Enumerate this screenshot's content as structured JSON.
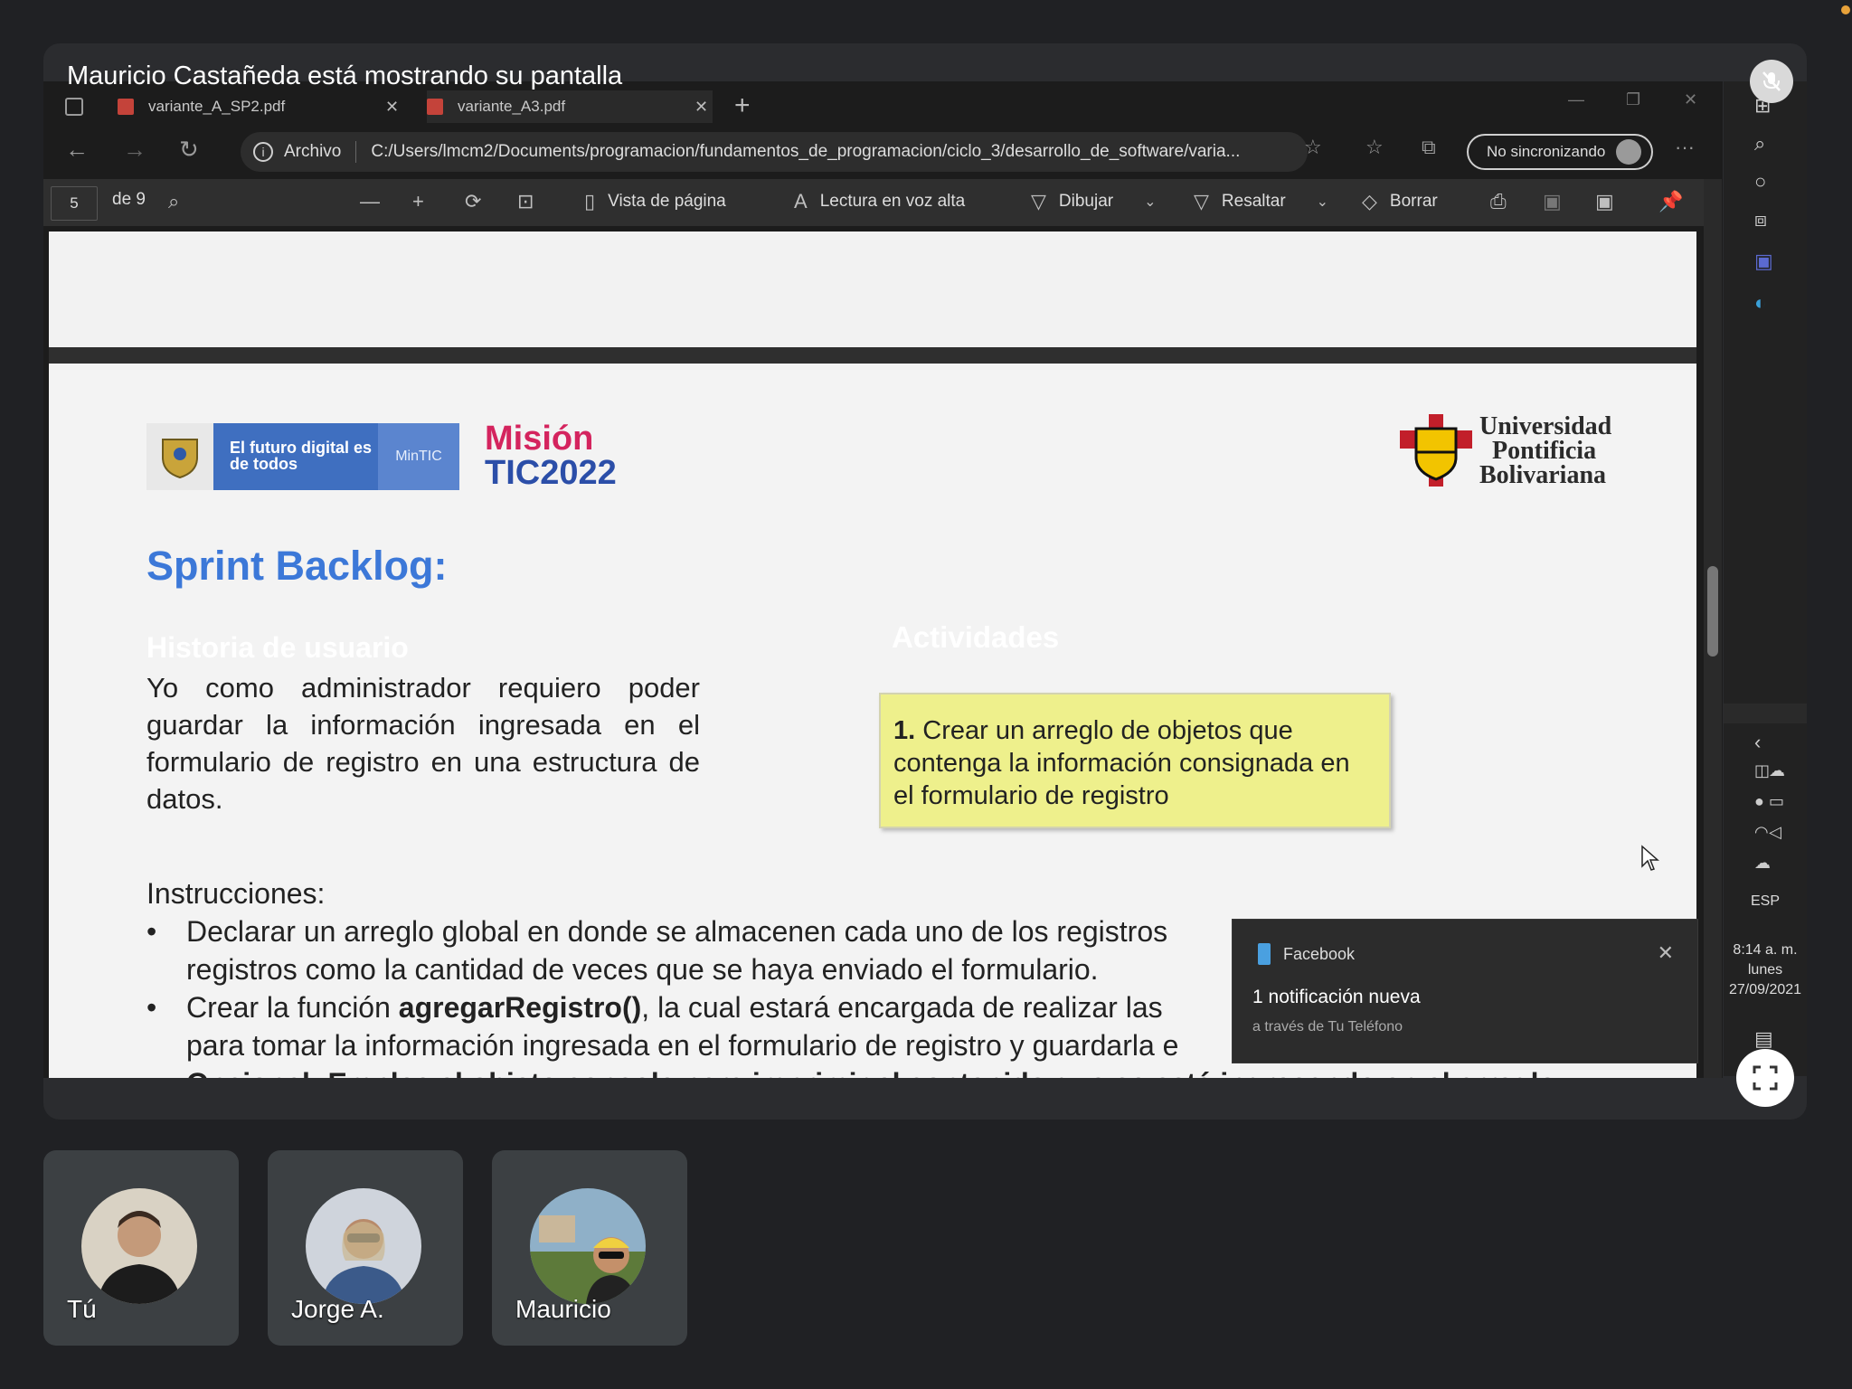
{
  "meeting": {
    "presenter_banner": "Mauricio Castañeda está mostrando su pantalla"
  },
  "browser": {
    "tabs": [
      {
        "label": "variante_A_SP2.pdf"
      },
      {
        "label": "variante_A3.pdf"
      }
    ],
    "address": {
      "scheme_label": "Archivo",
      "url": "C:/Users/lmcm2/Documents/programacion/fundamentos_de_programacion/ciclo_3/desarrollo_de_software/varia..."
    },
    "sync_label": "No sincronizando"
  },
  "pdf_toolbar": {
    "page_current": "5",
    "page_total": "de 9",
    "page_view_label": "Vista de página",
    "read_aloud_label": "Lectura en voz alta",
    "draw_label": "Dibujar",
    "highlight_label": "Resaltar",
    "erase_label": "Borrar"
  },
  "document": {
    "logo_govco_text": "El futuro digital es de todos",
    "logo_mintic": "MinTIC",
    "logo_mision_line1": "Misión",
    "logo_mision_line2": "TIC2022",
    "logo_upb_line1": "Universidad",
    "logo_upb_line2": "Pontificia",
    "logo_upb_line3": "Bolivariana",
    "sprint_title": "Sprint Backlog:",
    "historia_heading": "Historia de usuario",
    "historia_body": "Yo como administrador requiero poder guardar la información ingresada en el formulario de registro en una estructura de datos.",
    "actividades_heading": "Actividades",
    "activity_number": "1.",
    "activity_text": "Crear un arreglo de objetos que contenga la información consignada en el formulario de registro",
    "instrucciones_heading": "Instrucciones:",
    "bullet1_line1": "Declarar un arreglo global en donde se almacenen cada uno de los registros",
    "bullet1_line2": "registros como la cantidad de veces que se haya enviado el formulario.",
    "bullet2_line1_pre": "Crear la función ",
    "bullet2_line1_bold": "agregarRegistro()",
    "bullet2_line1_post": ", la cual estará encargada de realizar las",
    "bullet2_line2": "para tomar la información ingresada en el formulario de registro y guardarla e",
    "bullet3_partial": "Opcional: Emplee el objeto console para imprimir el contenido que se está ingresando en el arreglo"
  },
  "notification": {
    "app": "Facebook",
    "title": "1 notificación nueva",
    "subtitle": "a través de Tu Teléfono"
  },
  "taskbar": {
    "language": "ESP",
    "time": "8:14 a. m.",
    "day": "lunes",
    "date": "27/09/2021"
  },
  "participants": [
    {
      "name": "Tú"
    },
    {
      "name": "Jorge A."
    },
    {
      "name": "Mauricio"
    }
  ]
}
